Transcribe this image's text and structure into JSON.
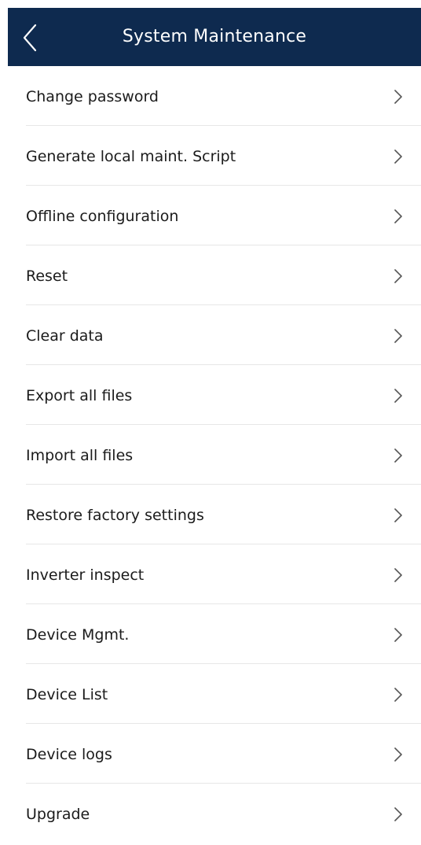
{
  "header": {
    "title": "System Maintenance",
    "back_icon": "chevron-left-icon",
    "background_color": "#0e2a4f"
  },
  "menu": {
    "chevron_icon": "chevron-right-icon",
    "items": [
      {
        "label": "Change password"
      },
      {
        "label": "Generate local maint. Script"
      },
      {
        "label": "Offline configuration"
      },
      {
        "label": "Reset"
      },
      {
        "label": "Clear data"
      },
      {
        "label": "Export all files"
      },
      {
        "label": "Import all files"
      },
      {
        "label": "Restore factory settings"
      },
      {
        "label": "Inverter inspect"
      },
      {
        "label": "Device Mgmt."
      },
      {
        "label": "Device List"
      },
      {
        "label": "Device logs"
      },
      {
        "label": "Upgrade"
      }
    ]
  }
}
